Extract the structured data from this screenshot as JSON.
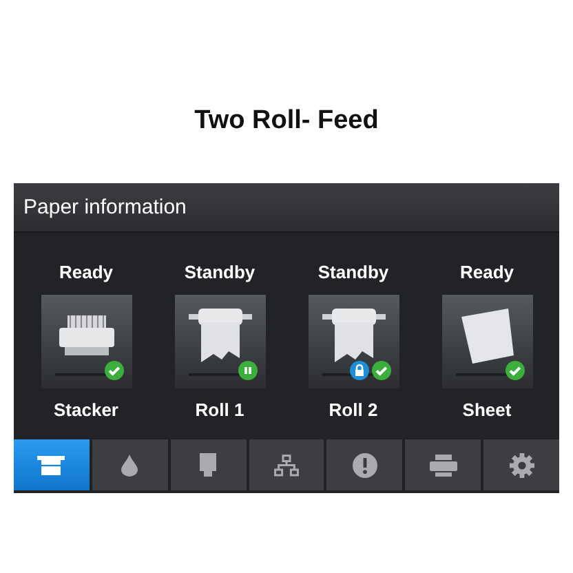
{
  "caption": "Two Roll- Feed",
  "screen": {
    "title": "Paper information",
    "tiles": [
      {
        "status": "Ready",
        "name": "Stacker",
        "kind": "stacker",
        "paused": false,
        "locked": false
      },
      {
        "status": "Standby",
        "name": "Roll 1",
        "kind": "roll",
        "paused": true,
        "locked": false
      },
      {
        "status": "Standby",
        "name": "Roll 2",
        "kind": "roll",
        "paused": false,
        "locked": true
      },
      {
        "status": "Ready",
        "name": "Sheet",
        "kind": "sheet",
        "paused": false,
        "locked": false
      }
    ],
    "tabs": [
      {
        "kind": "paper",
        "selected": true
      },
      {
        "kind": "ink",
        "selected": false
      },
      {
        "kind": "printhead",
        "selected": false
      },
      {
        "kind": "network",
        "selected": false
      },
      {
        "kind": "alert",
        "selected": false
      },
      {
        "kind": "printer",
        "selected": false
      },
      {
        "kind": "settings",
        "selected": false
      }
    ]
  }
}
